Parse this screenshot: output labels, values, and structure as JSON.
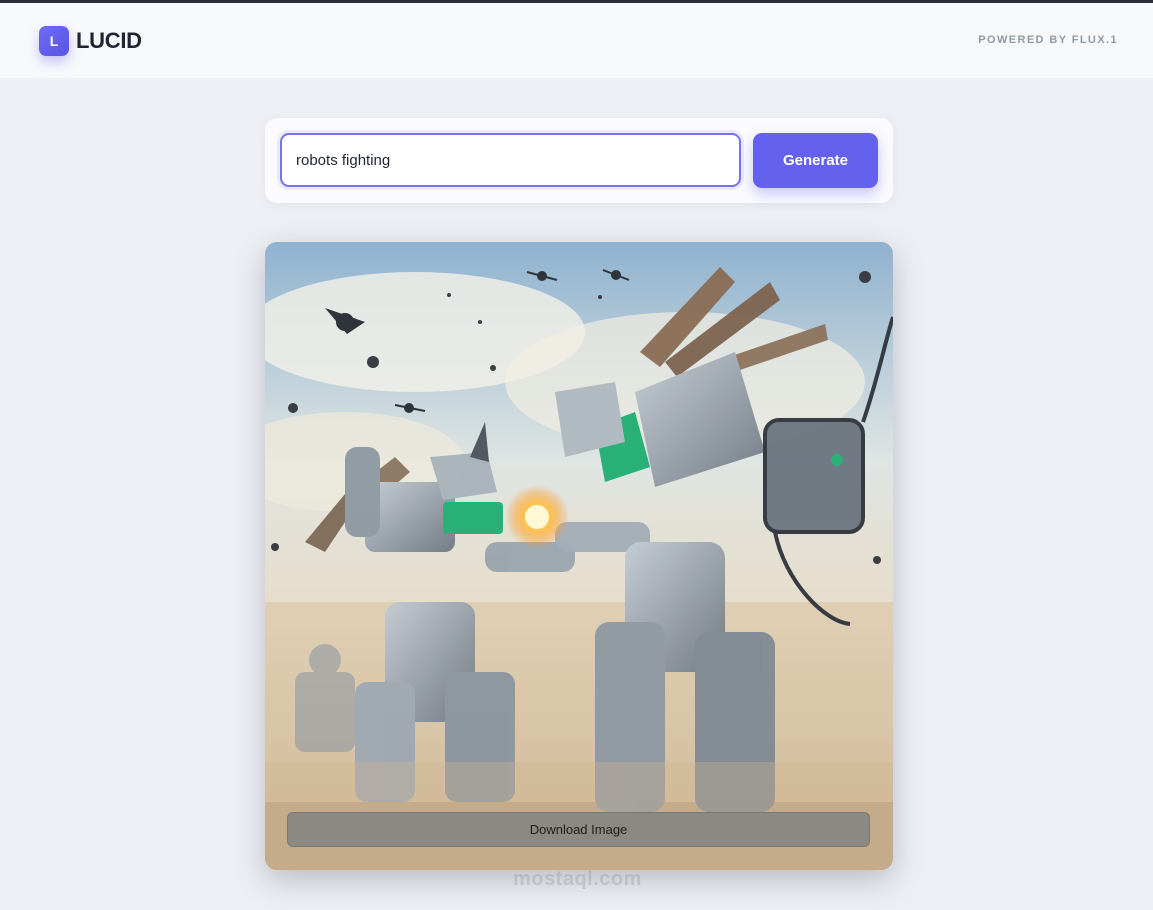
{
  "app": {
    "logo_letter": "L",
    "name": "LUCID",
    "powered_by": "POWERED BY FLUX.1"
  },
  "search": {
    "value": "robots fighting",
    "button_label": "Generate"
  },
  "result": {
    "download_label": "Download Image"
  },
  "watermark": {
    "text": "mostaql.com"
  },
  "colors": {
    "accent": "#6461ef",
    "logo_text": "#1f2533",
    "background": "#eeeff4"
  }
}
